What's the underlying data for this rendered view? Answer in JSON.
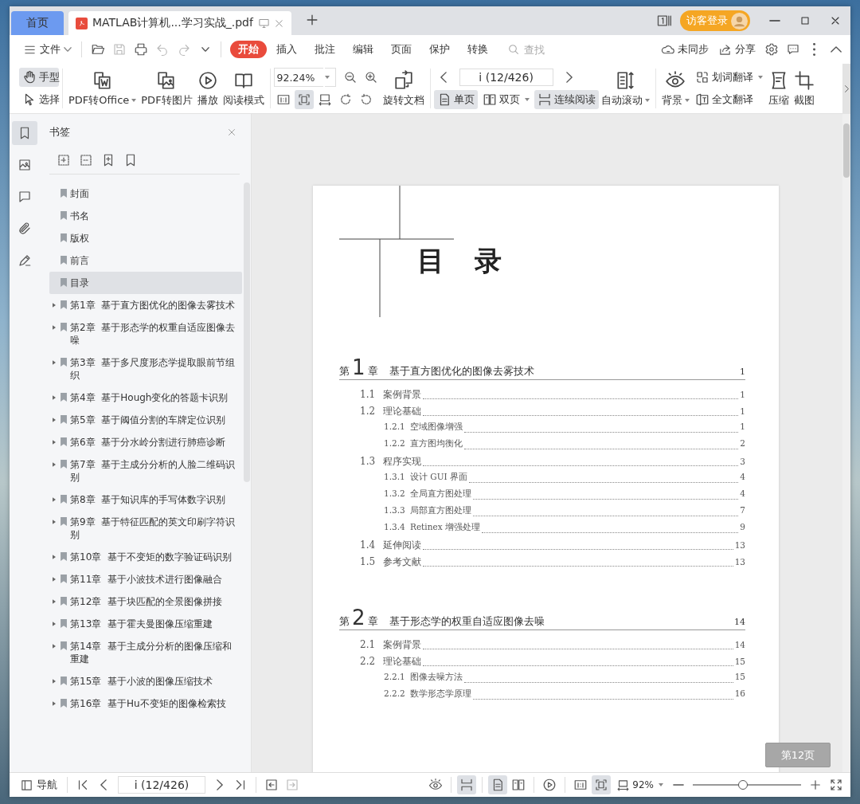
{
  "tabs": [
    {
      "label": "首页",
      "kind": "home",
      "selected": false
    },
    {
      "label": "MATLAB计算机...学习实战_.pdf",
      "kind": "document",
      "selected": true
    }
  ],
  "account": {
    "label": "访客登录"
  },
  "menu": {
    "file": "文件",
    "tabs": [
      {
        "label": "开始",
        "selected": true
      },
      {
        "label": "插入",
        "selected": false
      },
      {
        "label": "批注",
        "selected": false
      },
      {
        "label": "编辑",
        "selected": false
      },
      {
        "label": "页面",
        "selected": false
      },
      {
        "label": "保护",
        "selected": false
      },
      {
        "label": "转换",
        "selected": false
      }
    ],
    "search": {
      "placeholder": "查找"
    },
    "sync": "未同步",
    "share": "分享"
  },
  "toolbar": {
    "tools": [
      {
        "label": "手型",
        "selected": true
      },
      {
        "label": "选择",
        "selected": false
      }
    ],
    "pdf_to_office": "PDF转Office",
    "pdf_to_image": "PDF转图片",
    "play": "播放",
    "read_mode": "阅读模式",
    "zoom": {
      "value": "92.24%"
    },
    "fit_buttons": [
      {
        "selected": false
      },
      {
        "selected": true
      },
      {
        "selected": false
      }
    ],
    "rotate_document": "旋转文档",
    "page_field": {
      "value": "i (12/426)"
    },
    "view_buttons": [
      {
        "label": "单页",
        "selected": true
      },
      {
        "label": "双页",
        "selected": false
      },
      {
        "label": "连续阅读",
        "selected": true
      }
    ],
    "auto_scroll": "自动滚动",
    "background": "背景",
    "word_translate": "划词翻译",
    "full_translate": "全文翻译",
    "compress": "压缩",
    "screenshot": "截图"
  },
  "sidebar": {
    "rail": [
      {
        "selected": true
      },
      {
        "selected": false
      },
      {
        "selected": false
      },
      {
        "selected": false
      },
      {
        "selected": false
      }
    ],
    "title": "书签",
    "bookmarks": [
      {
        "label": "封面",
        "expandable": false,
        "selected": false
      },
      {
        "label": "书名",
        "expandable": false,
        "selected": false
      },
      {
        "label": "版权",
        "expandable": false,
        "selected": false
      },
      {
        "label": "前言",
        "expandable": false,
        "selected": false
      },
      {
        "label": "目录",
        "expandable": false,
        "selected": true
      },
      {
        "label": "第1章  基于直方图优化的图像去雾技术",
        "expandable": true,
        "selected": false
      },
      {
        "label": "第2章  基于形态学的权重自适应图像去噪",
        "expandable": true,
        "selected": false
      },
      {
        "label": "第3章  基于多尺度形态学提取眼前节组织",
        "expandable": true,
        "selected": false
      },
      {
        "label": "第4章  基于Hough变化的答题卡识别",
        "expandable": true,
        "selected": false
      },
      {
        "label": "第5章  基于阈值分割的车牌定位识别",
        "expandable": true,
        "selected": false
      },
      {
        "label": "第6章  基于分水岭分割进行肺癌诊断",
        "expandable": true,
        "selected": false
      },
      {
        "label": "第7章  基于主成分分析的人脸二维码识别",
        "expandable": true,
        "selected": false
      },
      {
        "label": "第8章  基于知识库的手写体数字识别",
        "expandable": true,
        "selected": false
      },
      {
        "label": "第9章  基于特征匹配的英文印刷字符识别",
        "expandable": true,
        "selected": false
      },
      {
        "label": "第10章  基于不变矩的数字验证码识别",
        "expandable": true,
        "selected": false
      },
      {
        "label": "第11章  基于小波技术进行图像融合",
        "expandable": true,
        "selected": false
      },
      {
        "label": "第12章  基于块匹配的全景图像拼接",
        "expandable": true,
        "selected": false
      },
      {
        "label": "第13章  基于霍夫曼图像压缩重建",
        "expandable": true,
        "selected": false
      },
      {
        "label": "第14章  基于主成分分析的图像压缩和重建",
        "expandable": true,
        "selected": false
      },
      {
        "label": "第15章  基于小波的图像压缩技术",
        "expandable": true,
        "selected": false
      },
      {
        "label": "第16章  基于Hu不变矩的图像检索技",
        "expandable": true,
        "selected": false
      }
    ]
  },
  "document": {
    "heading": "目 录",
    "chapters": [
      {
        "prefix": "第",
        "number": "1",
        "suffix": "章",
        "title": "基于直方图优化的图像去雾技术",
        "page": "1",
        "sections": [
          {
            "number": "1.1",
            "title": "案例背景",
            "page": "1"
          },
          {
            "number": "1.2",
            "title": "理论基础",
            "page": "1",
            "children": [
              {
                "number": "1.2.1",
                "title": "空域图像增强",
                "page": "1"
              },
              {
                "number": "1.2.2",
                "title": "直方图均衡化",
                "page": "2"
              }
            ]
          },
          {
            "number": "1.3",
            "title": "程序实现",
            "page": "3",
            "children": [
              {
                "number": "1.3.1",
                "title": "设计 GUI 界面",
                "page": "4"
              },
              {
                "number": "1.3.2",
                "title": "全局直方图处理",
                "page": "4"
              },
              {
                "number": "1.3.3",
                "title": "局部直方图处理",
                "page": "7"
              },
              {
                "number": "1.3.4",
                "title": "Retinex 增强处理",
                "page": "9"
              }
            ]
          },
          {
            "number": "1.4",
            "title": "延伸阅读",
            "page": "13"
          },
          {
            "number": "1.5",
            "title": "参考文献",
            "page": "13"
          }
        ]
      },
      {
        "prefix": "第",
        "number": "2",
        "suffix": "章",
        "title": "基于形态学的权重自适应图像去噪",
        "page": "14",
        "sections": [
          {
            "number": "2.1",
            "title": "案例背景",
            "page": "14"
          },
          {
            "number": "2.2",
            "title": "理论基础",
            "page": "15",
            "children": [
              {
                "number": "2.2.1",
                "title": "图像去噪方法",
                "page": "15"
              },
              {
                "number": "2.2.2",
                "title": "数学形态学原理",
                "page": "16"
              }
            ]
          }
        ]
      }
    ],
    "page_badge": "第12页"
  },
  "status_bar": {
    "nav": "导航",
    "page_field": {
      "value": "i (12/426)"
    },
    "view_buttons": [
      {
        "selected": true
      },
      {
        "selected": true
      },
      {
        "selected": false
      }
    ],
    "fit_buttons": [
      {
        "selected": false
      },
      {
        "selected": true
      }
    ],
    "zoom": "92%",
    "zoom_slider": {
      "level": 0.46
    }
  }
}
